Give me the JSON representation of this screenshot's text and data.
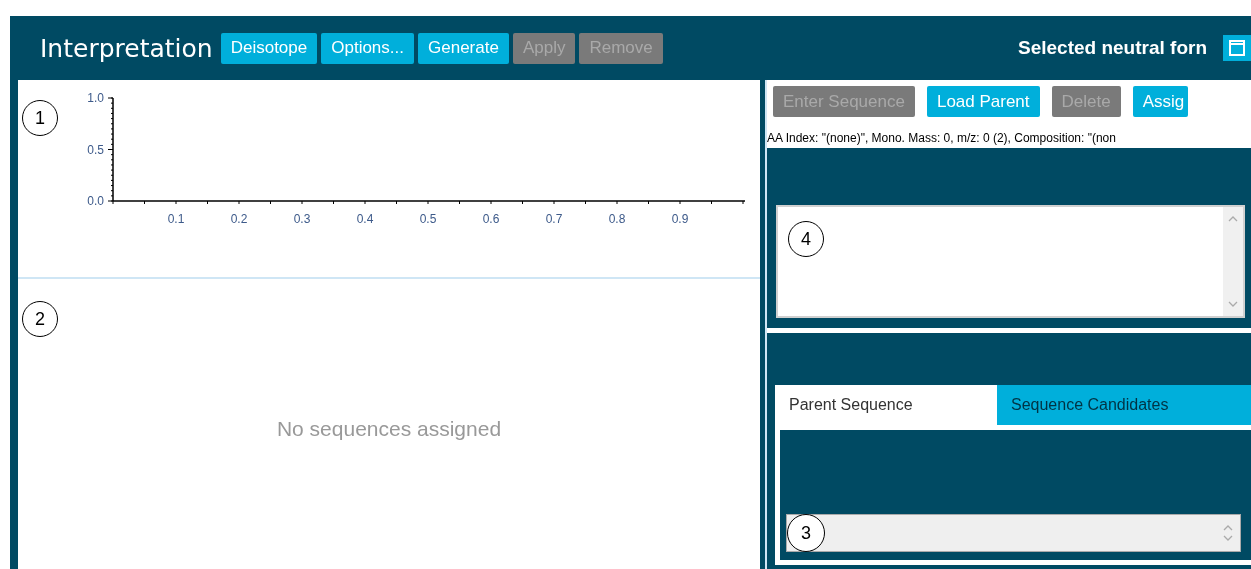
{
  "header": {
    "title": "Interpretation",
    "buttons": [
      {
        "label": "Deisotope",
        "disabled": false
      },
      {
        "label": "Options...",
        "disabled": false
      },
      {
        "label": "Generate",
        "disabled": false
      },
      {
        "label": "Apply",
        "disabled": true
      },
      {
        "label": "Remove",
        "disabled": true
      }
    ],
    "selected_label": "Selected neutral forn"
  },
  "chart": {
    "callout": "1",
    "chart_data": {
      "type": "line",
      "xlim": [
        0,
        1
      ],
      "ylim": [
        0,
        1
      ],
      "xticks": [
        0.1,
        0.2,
        0.3,
        0.4,
        0.5,
        0.6,
        0.7,
        0.8,
        0.9
      ],
      "yticks": [
        {
          "value": 0,
          "label": "0.0"
        },
        {
          "value": 0.5,
          "label": "0.5"
        },
        {
          "value": 1,
          "label": "1.0"
        }
      ]
    }
  },
  "sequences": {
    "callout": "2",
    "empty_message": "No sequences assigned"
  },
  "sequence_toolbar": {
    "buttons": [
      {
        "label": "Enter Sequence",
        "disabled": true
      },
      {
        "label": "Load Parent",
        "disabled": false
      },
      {
        "label": "Delete",
        "disabled": true
      },
      {
        "label": "Assig",
        "disabled": false
      }
    ]
  },
  "info_line": "AA Index: \"(none)\", Mono. Mass: 0, m/z: 0 (2), Composition: \"(non",
  "sequence_text": {
    "callout": "4"
  },
  "tabs": [
    {
      "label": "Parent Sequence",
      "selected": true
    },
    {
      "label": "Sequence Candidates",
      "selected": false
    }
  ],
  "parent_sequence": {
    "callout": "3"
  }
}
